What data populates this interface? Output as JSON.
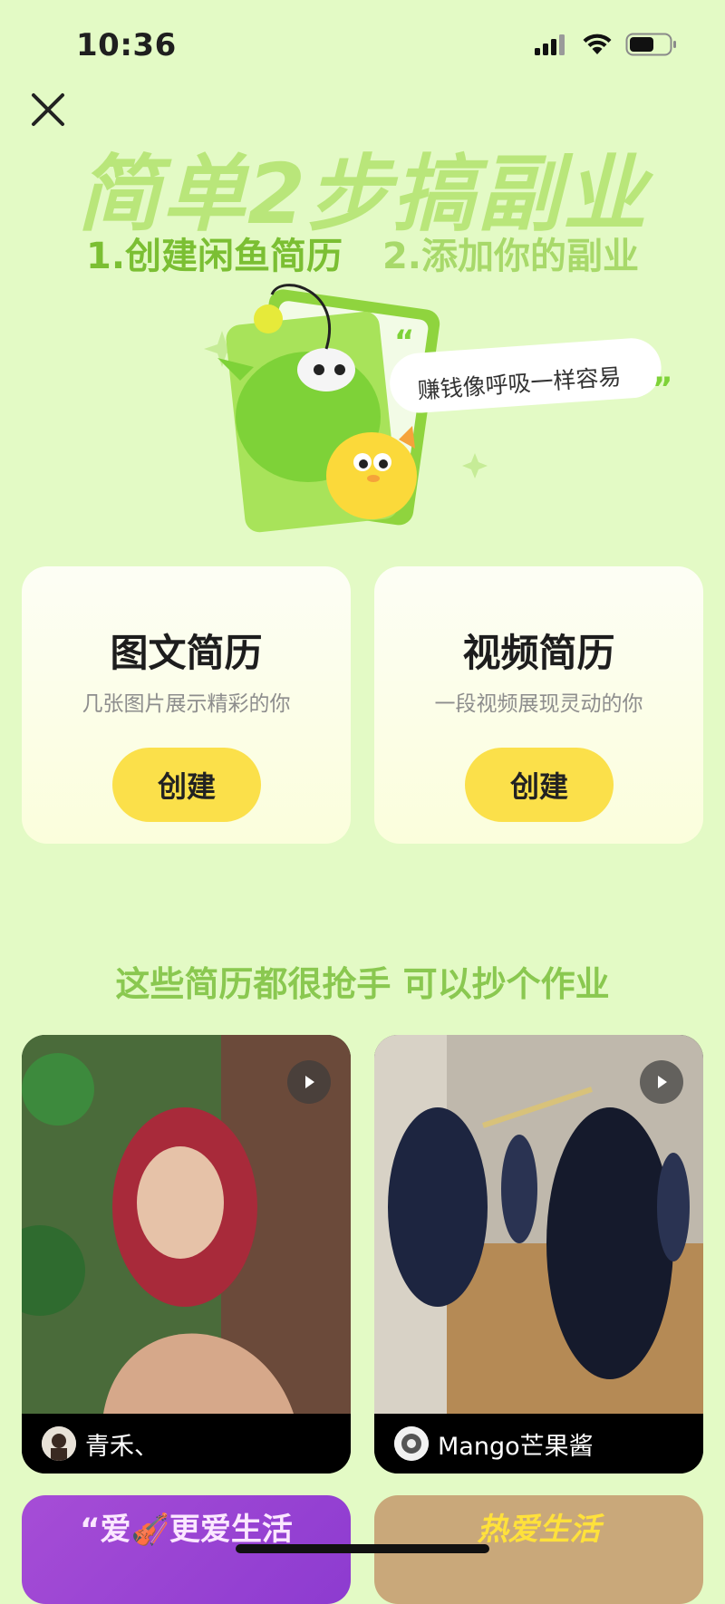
{
  "status_bar": {
    "time": "10:36"
  },
  "header": {
    "title": "简单2步搞副业",
    "step1": "1.创建闲鱼简历",
    "step2": "2.添加你的副业"
  },
  "illustration": {
    "bubble_text": "赚钱像呼吸一样容易"
  },
  "cards": [
    {
      "title": "图文简历",
      "subtitle": "几张图片展示精彩的你",
      "button": "创建"
    },
    {
      "title": "视频简历",
      "subtitle": "一段视频展现灵动的你",
      "button": "创建"
    }
  ],
  "section": {
    "title": "这些简历都很抢手 可以抄个作业"
  },
  "examples": [
    {
      "author": "青禾、",
      "type": "video"
    },
    {
      "author": "Mango芒果酱",
      "type": "video"
    }
  ],
  "more_examples": [
    {
      "text": "“爱🎻更爱生活"
    },
    {
      "text": "热爱生活"
    }
  ],
  "colors": {
    "background": "#e3fac5",
    "accent_green": "#7bbf33",
    "button_yellow": "#fbe04a"
  }
}
